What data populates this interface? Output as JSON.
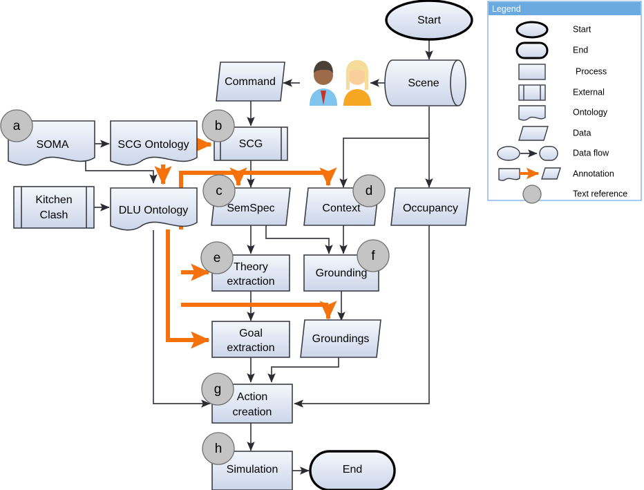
{
  "diagram": {
    "title": "Knowledge processing pipeline flowchart",
    "colors": {
      "annotation": "#f4710b",
      "shape_fill_top": "#f2f5fb",
      "shape_fill_bottom": "#ccd6ea",
      "shape_stroke": "#3b3b44",
      "legend_header": "#6aaae0",
      "legend_border": "#7fb2e5",
      "text_reference_fill": "#c4c4c4"
    },
    "nodes": [
      {
        "id": "start",
        "label": "Start",
        "type": "start"
      },
      {
        "id": "scene",
        "label": "Scene",
        "type": "cylinder"
      },
      {
        "id": "command",
        "label": "Command",
        "type": "data"
      },
      {
        "id": "soma",
        "label": "SOMA",
        "type": "ontology",
        "ref": "a"
      },
      {
        "id": "scg_ontology",
        "label": "SCG Ontology",
        "type": "ontology"
      },
      {
        "id": "scg",
        "label": "SCG",
        "type": "external",
        "ref": "b"
      },
      {
        "id": "kitchen_clash",
        "label": "Kitchen\nClash",
        "type": "external"
      },
      {
        "id": "dlu_ontology",
        "label": "DLU Ontology",
        "type": "ontology"
      },
      {
        "id": "semspec",
        "label": "SemSpec",
        "type": "data",
        "ref": "c"
      },
      {
        "id": "context",
        "label": "Context",
        "type": "data",
        "ref": "d"
      },
      {
        "id": "occupancy",
        "label": "Occupancy",
        "type": "data"
      },
      {
        "id": "theory",
        "label": "Theory\nextraction",
        "type": "process",
        "ref": "e"
      },
      {
        "id": "grounding",
        "label": "Grounding",
        "type": "process",
        "ref": "f"
      },
      {
        "id": "goal",
        "label": "Goal\nextraction",
        "type": "process"
      },
      {
        "id": "groundings",
        "label": "Groundings",
        "type": "data"
      },
      {
        "id": "action",
        "label": "Action\ncreation",
        "type": "process",
        "ref": "g"
      },
      {
        "id": "simulation",
        "label": "Simulation",
        "type": "process",
        "ref": "h"
      },
      {
        "id": "end",
        "label": "End",
        "type": "end"
      }
    ],
    "node_labels": {
      "start": "Start",
      "scene": "Scene",
      "command": "Command",
      "soma": "SOMA",
      "scg_ontology": "SCG Ontology",
      "scg": "SCG",
      "kitchen_clash_line1": "Kitchen",
      "kitchen_clash_line2": "Clash",
      "dlu_ontology": "DLU Ontology",
      "semspec": "SemSpec",
      "context": "Context",
      "occupancy": "Occupancy",
      "theory_line1": "Theory",
      "theory_line2": "extraction",
      "grounding": "Grounding",
      "goal_line1": "Goal",
      "goal_line2": "extraction",
      "groundings": "Groundings",
      "action_line1": "Action",
      "action_line2": "creation",
      "simulation": "Simulation",
      "end": "End"
    },
    "text_references": {
      "a": "a",
      "b": "b",
      "c": "c",
      "d": "d",
      "e": "e",
      "f": "f",
      "g": "g",
      "h": "h"
    },
    "actors": [
      {
        "id": "actor-male",
        "hair": "#4a4038",
        "skin": "#9c6b4a",
        "shirt": "#7fc3ef",
        "tie": "#c8342a"
      },
      {
        "id": "actor-female",
        "hair": "#f6dc9a",
        "skin": "#fbcf9b",
        "shirt": "#f5a623",
        "tie": ""
      }
    ],
    "data_flows": [
      {
        "from": "start",
        "to": "scene"
      },
      {
        "from": "scene",
        "to": "actors"
      },
      {
        "from": "actors",
        "to": "command"
      },
      {
        "from": "command",
        "to": "scg"
      },
      {
        "from": "soma",
        "to": "scg_ontology"
      },
      {
        "from": "soma",
        "to": "dlu_ontology"
      },
      {
        "from": "kitchen_clash",
        "to": "dlu_ontology"
      },
      {
        "from": "scg",
        "to": "semspec"
      },
      {
        "from": "scene",
        "to": "context"
      },
      {
        "from": "scene",
        "to": "occupancy"
      },
      {
        "from": "semspec",
        "to": "theory"
      },
      {
        "from": "semspec",
        "to": "grounding"
      },
      {
        "from": "context",
        "to": "grounding"
      },
      {
        "from": "theory",
        "to": "goal"
      },
      {
        "from": "grounding",
        "to": "groundings"
      },
      {
        "from": "goal",
        "to": "action"
      },
      {
        "from": "groundings",
        "to": "action"
      },
      {
        "from": "dlu_ontology",
        "to": "action"
      },
      {
        "from": "occupancy",
        "to": "action"
      },
      {
        "from": "action",
        "to": "simulation"
      },
      {
        "from": "simulation",
        "to": "end"
      }
    ],
    "annotations": [
      {
        "from": "soma",
        "to": "kitchen_clash"
      },
      {
        "from": "scg_ontology",
        "to": "scg"
      },
      {
        "from": "dlu_ontology",
        "to": "semspec"
      },
      {
        "from": "dlu_ontology",
        "to": "context"
      },
      {
        "from": "dlu_ontology",
        "to": "theory"
      },
      {
        "from": "dlu_ontology",
        "to": "goal"
      },
      {
        "from": "theory",
        "to": "groundings"
      }
    ]
  },
  "legend": {
    "title": "Legend",
    "items": [
      {
        "icon": "start-shape-icon",
        "label": "Start"
      },
      {
        "icon": "end-shape-icon",
        "label": "End"
      },
      {
        "icon": "process-shape-icon",
        "label": "Process"
      },
      {
        "icon": "external-shape-icon",
        "label": "External"
      },
      {
        "icon": "ontology-shape-icon",
        "label": "Ontology"
      },
      {
        "icon": "data-shape-icon",
        "label": "Data"
      },
      {
        "icon": "data-flow-arrow-icon",
        "label": "Data flow"
      },
      {
        "icon": "annotation-arrow-icon",
        "label": "Annotation"
      },
      {
        "icon": "text-reference-circle-icon",
        "label": "Text reference"
      }
    ]
  }
}
